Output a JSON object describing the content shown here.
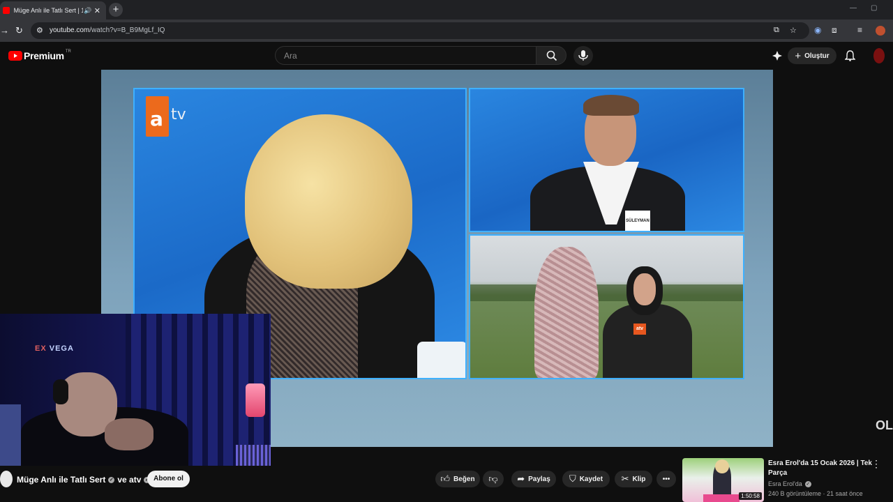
{
  "browser": {
    "tab_title": "Müge Anlı ile Tatlı Sert | 16",
    "url_domain": "youtube.com",
    "url_path": "/watch?v=B_B9MgLf_IQ"
  },
  "header": {
    "brand": "Premium",
    "region": "TR",
    "search_placeholder": "Ara",
    "create_label": "Oluştur"
  },
  "video": {
    "tv_logo_letter": "a",
    "tv_logo_text": "tv",
    "guest_nametag": "SÜLEYMAN",
    "mic_logo": "atv",
    "corner_brand": "OL"
  },
  "webcam": {
    "sign_ex": "EX",
    "sign_text": "VEGA"
  },
  "channel": {
    "name": "Müge Anlı ile Tatlı Sert",
    "joiner": "ve atv",
    "subscribe_label": "Abone ol"
  },
  "actions": {
    "like": "Beğen",
    "share": "Paylaş",
    "save": "Kaydet",
    "clip": "Klip"
  },
  "recommended": {
    "title": "Esra Erol'da 15 Ocak 2026 | Tek Parça",
    "channel": "Esra Erol'da",
    "meta": "240 B görüntüleme · 21 saat önce",
    "duration": "1:50:58"
  }
}
